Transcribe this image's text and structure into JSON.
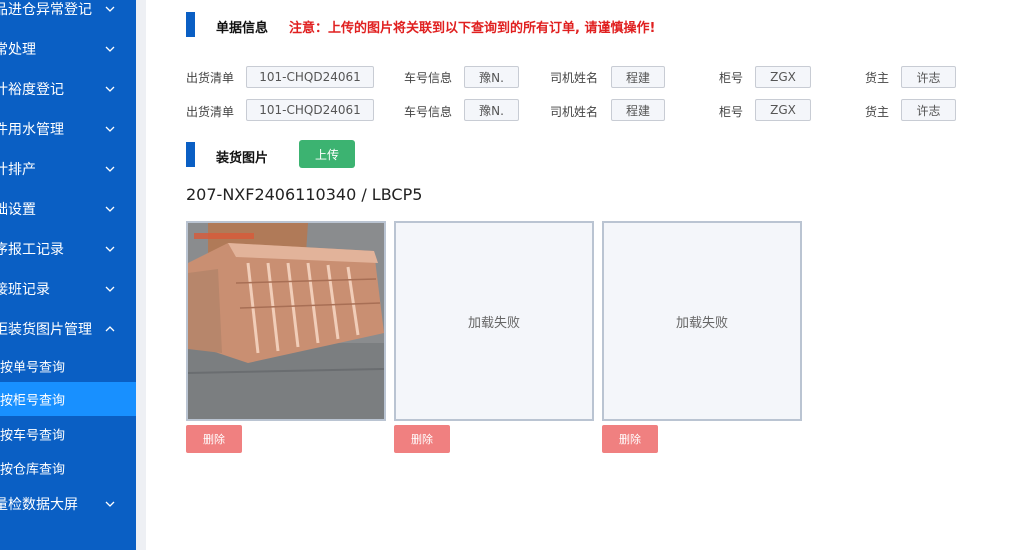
{
  "sidebar": {
    "items": [
      {
        "label": "品进仓异常登记"
      },
      {
        "label": "常处理"
      },
      {
        "label": "计裕度登记"
      },
      {
        "label": "件用水管理"
      },
      {
        "label": "计排产"
      },
      {
        "label": "础设置"
      },
      {
        "label": "序报工记录"
      },
      {
        "label": "接班记录"
      },
      {
        "label": "柜装货图片管理"
      },
      {
        "label": "按单号查询"
      },
      {
        "label": "按柜号查询"
      },
      {
        "label": "按车号查询"
      },
      {
        "label": "按仓库查询"
      },
      {
        "label": "量检数据大屏"
      }
    ],
    "active_index": 10
  },
  "doc_section": {
    "title": "单据信息",
    "warning": "注意：上传的图片将关联到以下查询到的所有订单, 请谨慎操作!"
  },
  "fields": {
    "labels": [
      "出货清单",
      "车号信息",
      "司机姓名",
      "柜号",
      "货主"
    ],
    "rows": [
      [
        "101-CHQD24061",
        "豫N.",
        "程建",
        "ZGX",
        "许志"
      ],
      [
        "101-CHQD24061",
        "豫N.",
        "程建",
        "ZGX",
        "许志"
      ]
    ]
  },
  "photo_section": {
    "title": "装货图片",
    "upload_label": "上传",
    "group_code": "207-NXF2406110340 / LBCP5",
    "images": [
      {
        "status": "loaded",
        "failed_text": ""
      },
      {
        "status": "failed",
        "failed_text": "加载失败"
      },
      {
        "status": "failed",
        "failed_text": "加载失败"
      }
    ],
    "delete_label": "删除"
  },
  "colors": {
    "sidebar_bg": "#0a5fc4",
    "sidebar_active": "#1890ff",
    "upload_button": "#3cb371",
    "delete_button": "#f08080",
    "warning_text": "#e02020"
  }
}
